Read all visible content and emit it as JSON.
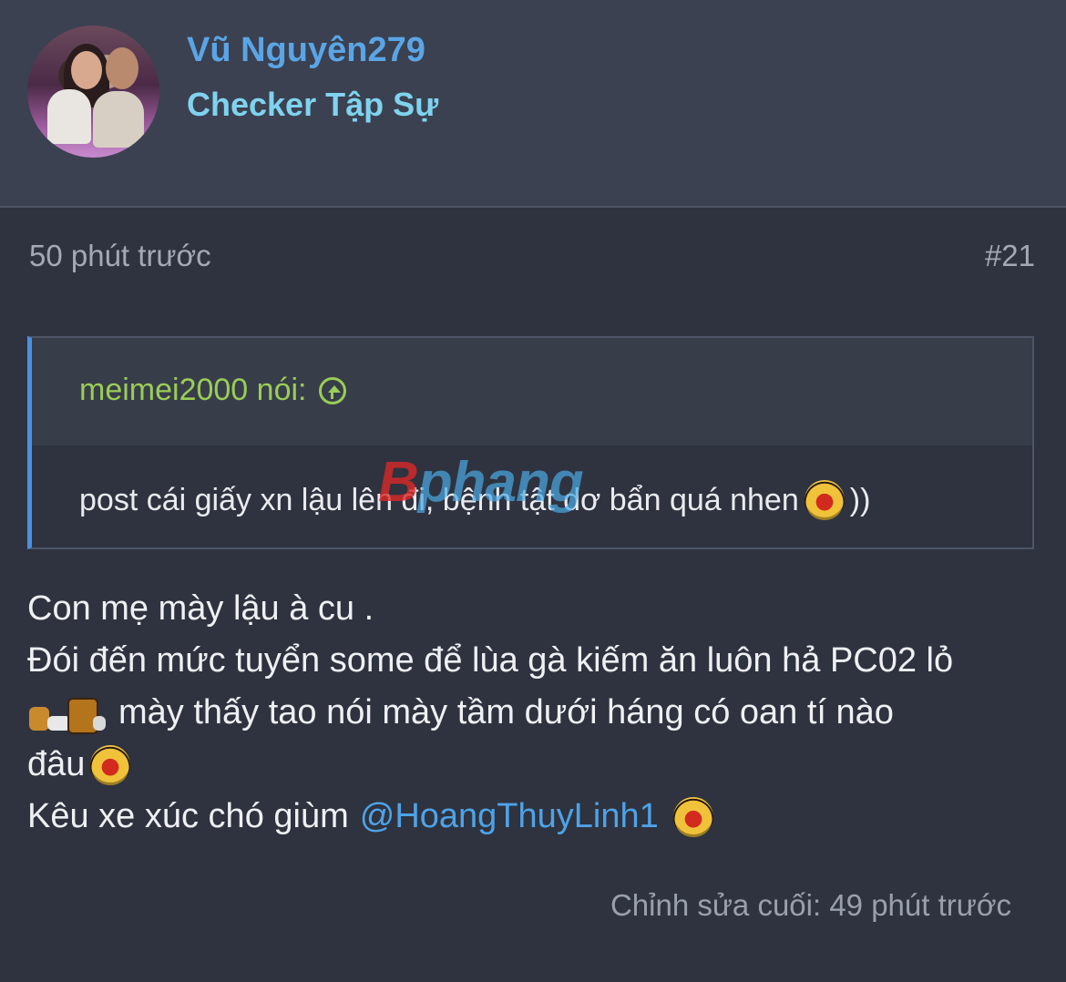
{
  "header": {
    "username": "Vũ Nguyên279",
    "user_title": "Checker Tập Sự"
  },
  "post": {
    "time": "50 phút trước",
    "number": "#21",
    "quote": {
      "author": "meimei2000 nói:",
      "text_before_emoji": "post cái giấy xn lậu lên đi, bệnh tật dơ bẩn quá nhen",
      "text_after_emoji": "))"
    },
    "body": {
      "line1": "Con mẹ mày lậu à cu .",
      "line2": "Đói đến mức tuyển some để lùa gà kiếm ăn luôn hả PC02 lỏ",
      "line3": "mày thấy tao nói mày tầm dưới háng có oan tí nào",
      "line4": "đâu",
      "line5_prefix": "Kêu xe xúc chó giùm",
      "mention": "@HoangThuyLinh1"
    },
    "edited": "Chỉnh sửa cuối: 49 phút trước"
  },
  "watermark": {
    "first": "B",
    "rest": "phang"
  },
  "colors": {
    "background": "#2f333f",
    "header_bg": "#3b4150",
    "username": "#5aa5e6",
    "user_title": "#7fd3ef",
    "quote_author": "#9acd56",
    "quote_border": "#4a90e2",
    "mention": "#4da3e8"
  },
  "icons": {
    "quote_jump": "arrow-up-circle-icon",
    "emoji_laugh": "laughing-smiley-icon",
    "emoji_combo": "sticker-combo-icon"
  }
}
